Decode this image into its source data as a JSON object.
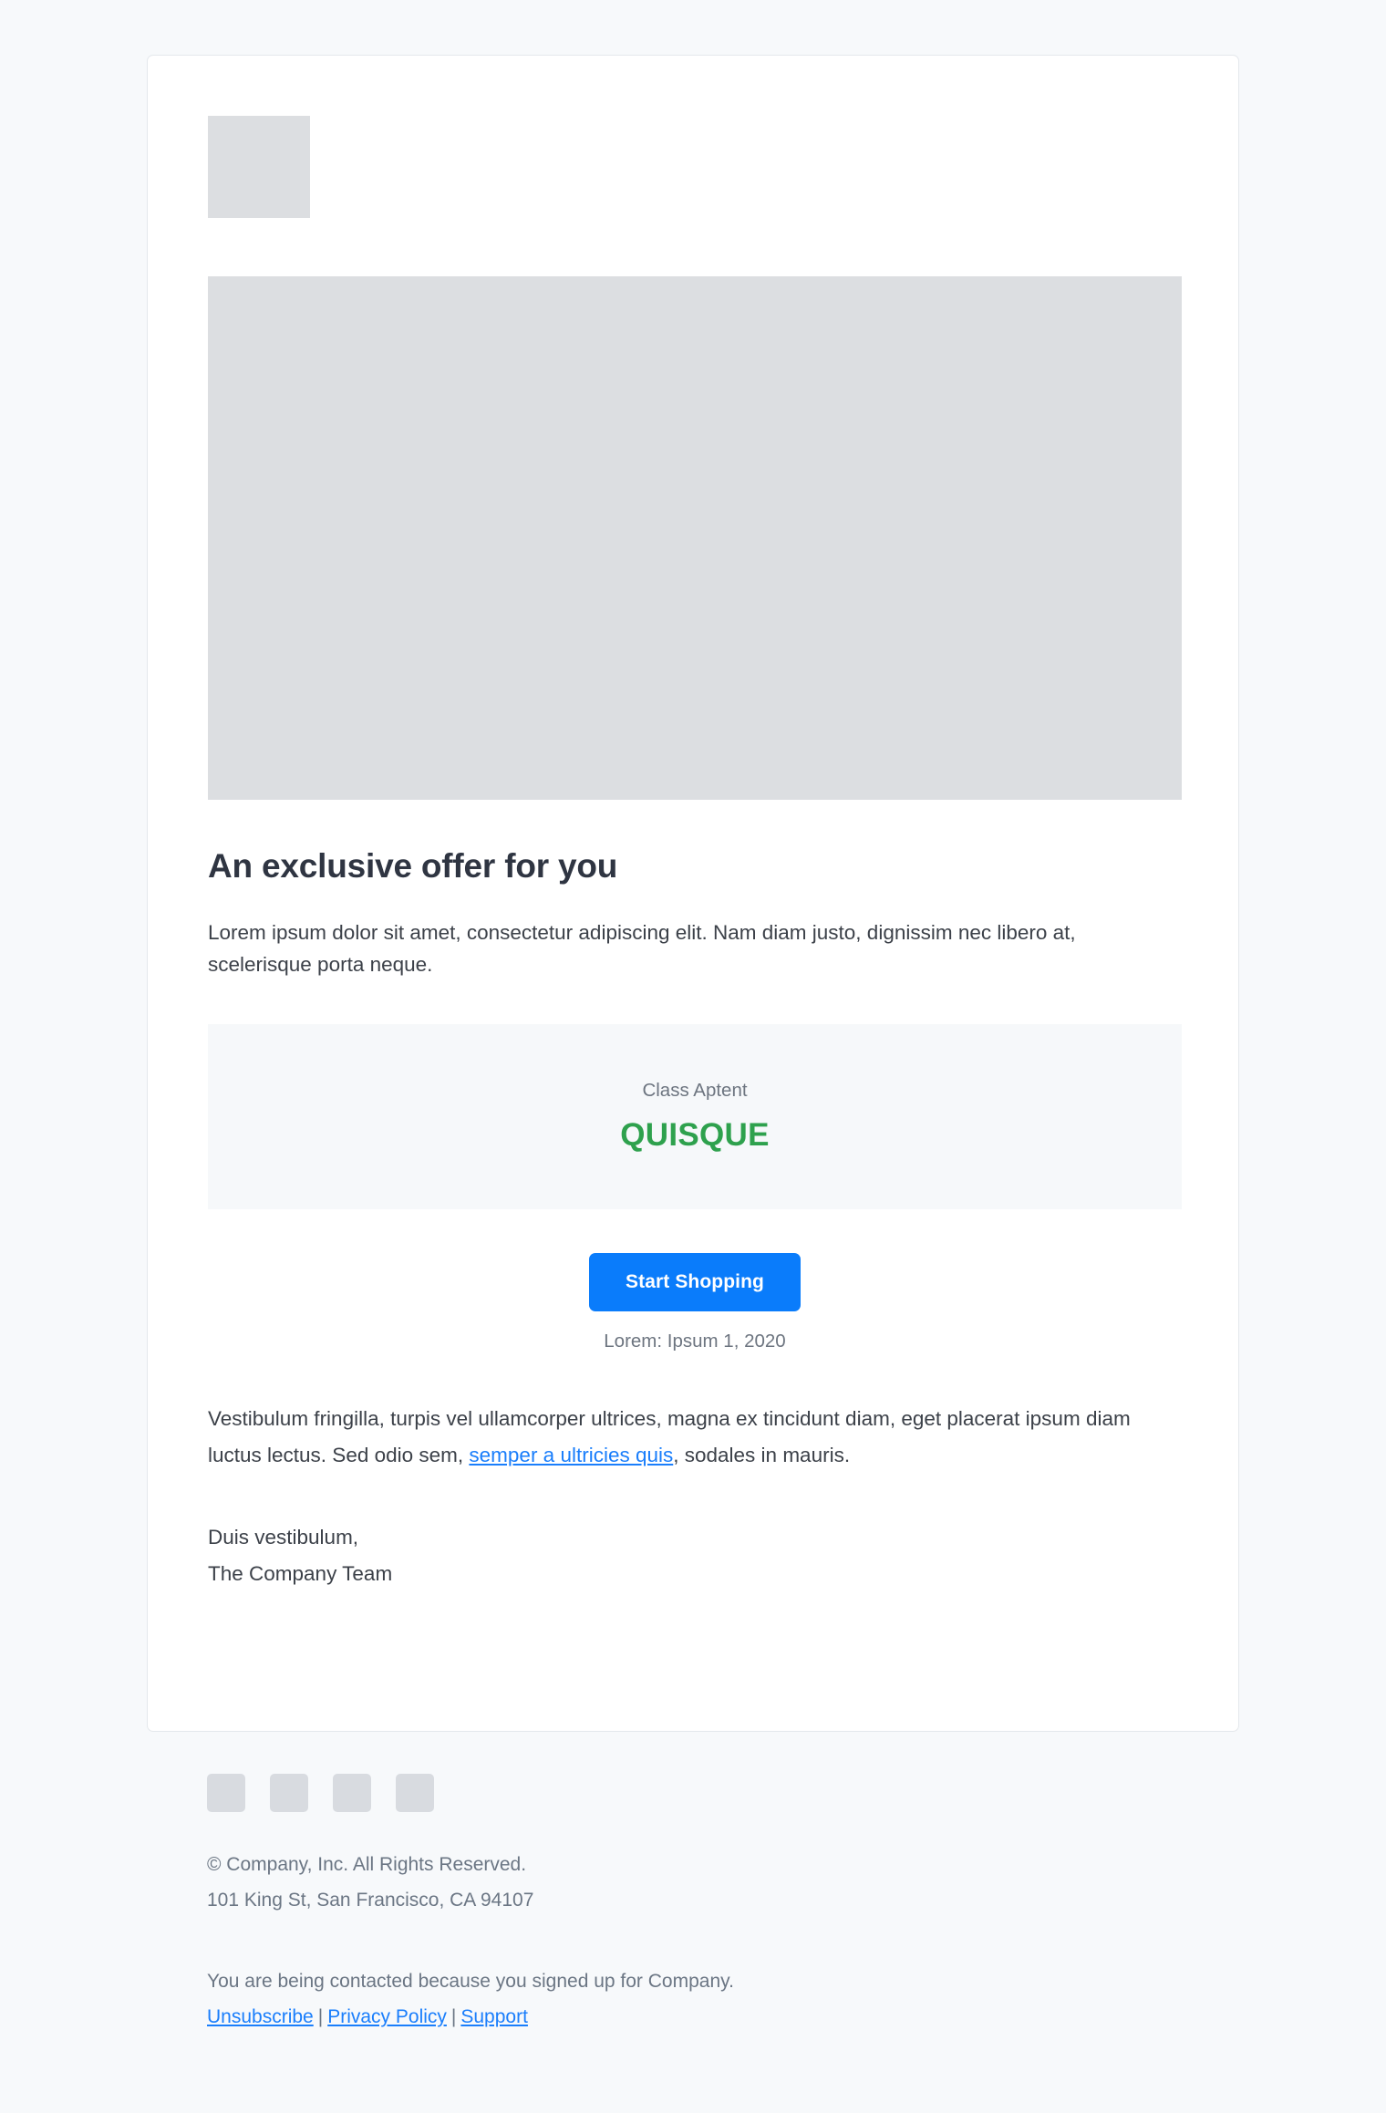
{
  "theme": {
    "page_background": "#f7f9fb",
    "card_background": "#ffffff",
    "card_border": "#e4e8ec",
    "accent_blue": "#0a7cfb",
    "link_blue": "#1a7efb",
    "promo_green": "#2ea14d",
    "promo_box_background": "#f6f8fa",
    "placeholder_gray": "#dcdee1",
    "muted_text": "#6d7580",
    "body_text": "#3c4149",
    "heading_text": "#2f3542"
  },
  "header": {
    "logo_alt": "logo-placeholder"
  },
  "hero": {
    "image_alt": "hero-image-placeholder"
  },
  "main": {
    "headline": "An exclusive offer for you",
    "intro_paragraph": "Lorem ipsum dolor sit amet, consectetur adipiscing elit. Nam diam justo, dignissim nec libero at, scelerisque porta neque.",
    "promo": {
      "label": "Class Aptent",
      "code": "QUISQUE"
    },
    "cta": {
      "button_label": "Start Shopping",
      "note": "Lorem: Ipsum 1, 2020"
    },
    "body_paragraph": {
      "before_link": "Vestibulum fringilla, turpis vel ullamcorper ultrices, magna ex tincidunt diam, eget placerat ipsum diam luctus lectus. Sed odio sem, ",
      "link_text": "semper a ultricies quis",
      "after_link": ", sodales in mauris."
    },
    "signature": {
      "line1": "Duis vestibulum,",
      "line2": "The Company Team"
    }
  },
  "footer": {
    "social_icons": [
      {
        "name": "social-icon-1"
      },
      {
        "name": "social-icon-2"
      },
      {
        "name": "social-icon-3"
      },
      {
        "name": "social-icon-4"
      }
    ],
    "legal": {
      "copyright": "© Company, Inc. All Rights Reserved.",
      "address": "101 King St, San Francisco, CA 94107"
    },
    "consent_text": "You are being contacted because you signed up for Company.",
    "links": [
      {
        "label": "Unsubscribe"
      },
      {
        "label": "Privacy Policy"
      },
      {
        "label": "Support"
      }
    ],
    "separator": "|"
  }
}
